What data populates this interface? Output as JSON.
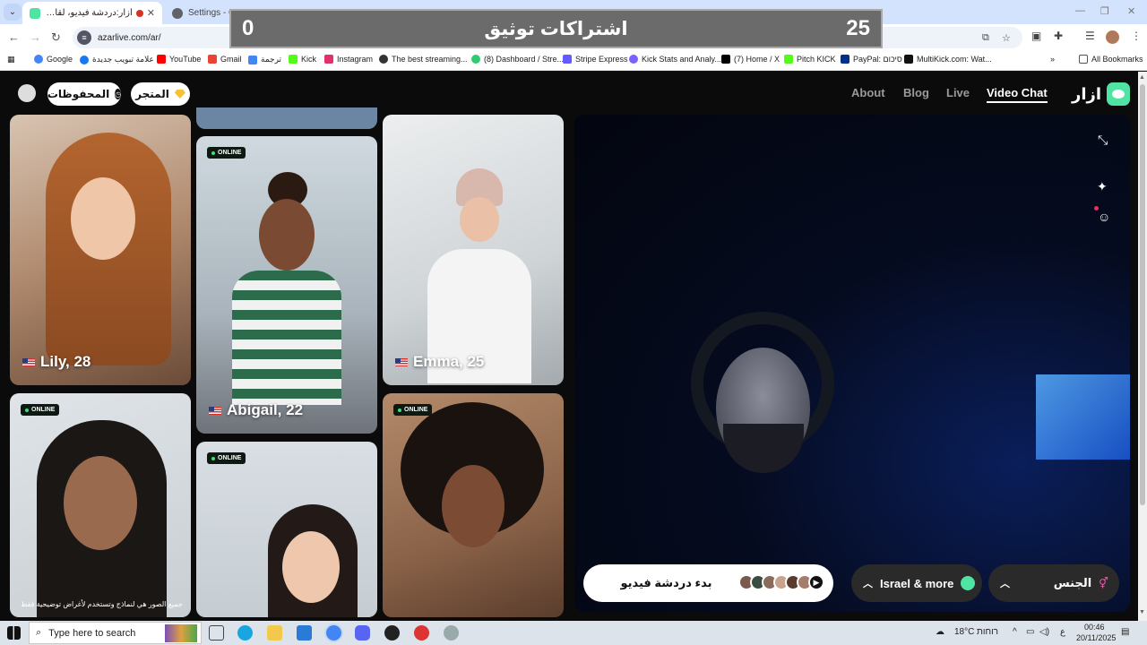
{
  "browser": {
    "tabs": [
      {
        "title": "أزار:دردشة فيديو، لقاء الأصدقاء",
        "active": true,
        "recording": true
      },
      {
        "title": "Settings - Cameras",
        "active": false
      }
    ],
    "url": "azarlive.com/ar/",
    "bookmarks": [
      {
        "label": "Google",
        "color": "#4285f4"
      },
      {
        "label": "علامة تبويب جديدة",
        "color": "#1877f2"
      },
      {
        "label": "YouTube",
        "color": "#ff0000"
      },
      {
        "label": "Gmail",
        "color": "#ea4335"
      },
      {
        "label": "ترجمة",
        "color": "#4285f4"
      },
      {
        "label": "Kick",
        "color": "#53fc18"
      },
      {
        "label": "Instagram",
        "color": "#e1306c"
      },
      {
        "label": "The best streaming...",
        "color": "#333333"
      },
      {
        "label": "(8) Dashboard / Stre...",
        "color": "#2ecc71"
      },
      {
        "label": "Stripe Express",
        "color": "#635bff"
      },
      {
        "label": "Kick Stats and Analy...",
        "color": "#7b61ff"
      },
      {
        "label": "(7) Home / X",
        "color": "#000000"
      },
      {
        "label": "Pitch KICK",
        "color": "#53fc18"
      },
      {
        "label": "PayPal: סיכום",
        "color": "#003087"
      },
      {
        "label": "MultiKick.com: Wat...",
        "color": "#111111"
      }
    ],
    "all_bookmarks": "All Bookmarks"
  },
  "overlay": {
    "left_value": "0",
    "title": "اشتراكات توثيق",
    "right_value": "25"
  },
  "nav": {
    "saved": "المحفوظات",
    "store": "المتجر",
    "links": [
      "About",
      "Blog",
      "Live",
      "Video Chat"
    ],
    "active_link": "Video Chat",
    "brand": "ازار"
  },
  "cards": {
    "online": "ONLINE",
    "lily": "Lily, 28",
    "abigail": "Abigail, 22",
    "emma": "Emma, 25",
    "disclaimer": "جميع الصور هي لنماذج وتستخدم لأغراض توضيحية فقط"
  },
  "controls": {
    "start_chat": "بدء دردشة فيديو",
    "region": "Israel & more",
    "gender": "الجنس"
  },
  "taskbar": {
    "search_placeholder": "Type here to search",
    "weather_temp": "18°C",
    "weather_text": "רוחות",
    "lang": "ع",
    "time": "00:46",
    "date": "20/11/2025"
  },
  "colors": {
    "accent_green": "#4fe4a4",
    "online_dot": "#3ee07d",
    "chrome_tab_bg": "#d3e3fd"
  }
}
